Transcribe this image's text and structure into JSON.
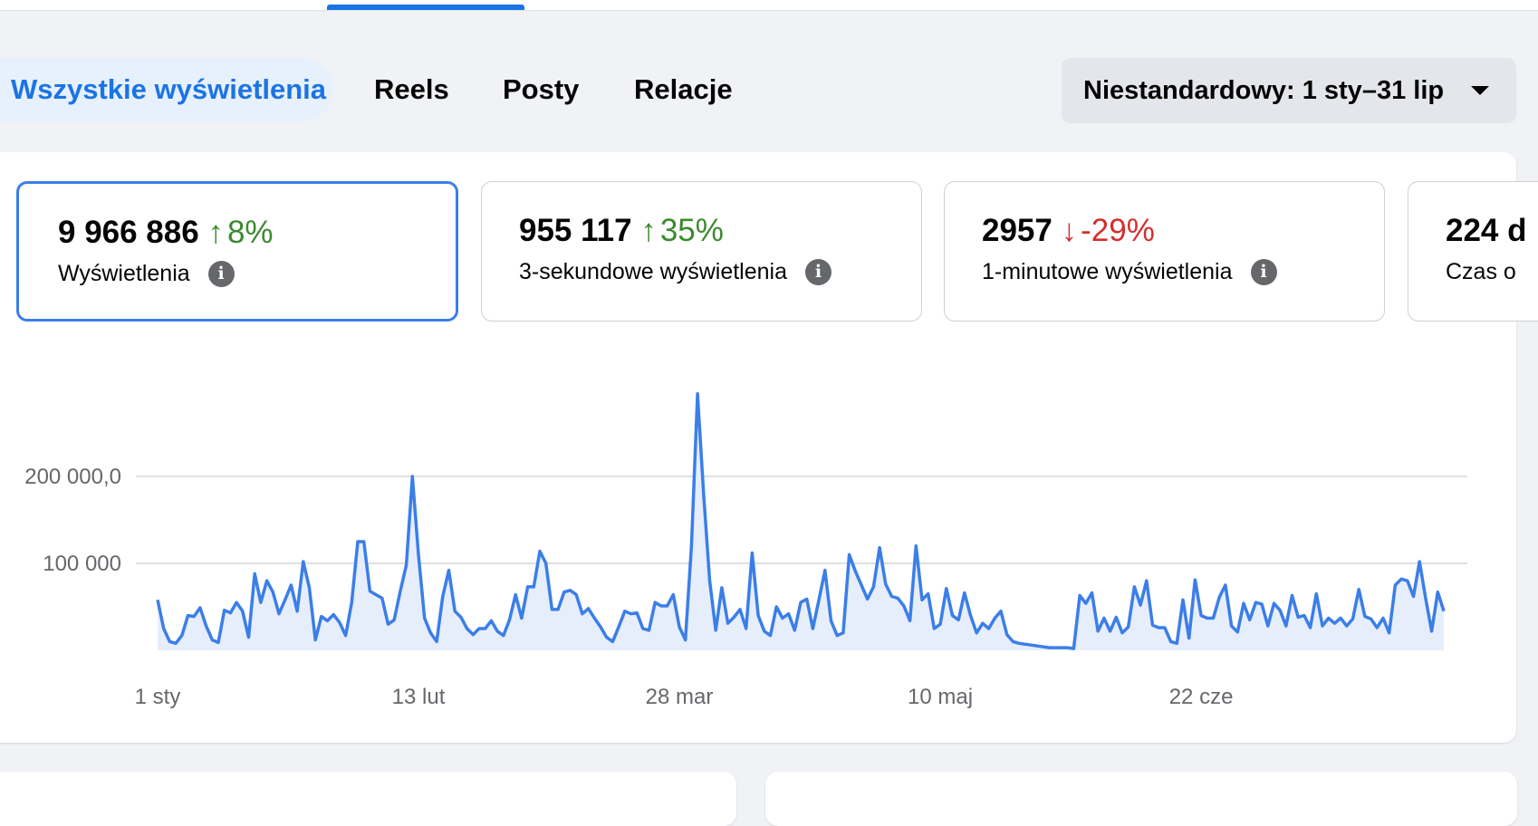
{
  "tabs": [
    {
      "label": "Wszystkie wyświetlenia",
      "active": true
    },
    {
      "label": "Reels",
      "active": false
    },
    {
      "label": "Posty",
      "active": false
    },
    {
      "label": "Relacje",
      "active": false
    }
  ],
  "date_filter": {
    "label": "Niestandardowy: 1 sty–31 lip",
    "icon": "caret-down-icon"
  },
  "metrics": [
    {
      "value": "9 966 886",
      "arrow": "↑",
      "change": "8%",
      "trend": "up",
      "label": "Wyświetlenia",
      "selected": true
    },
    {
      "value": "955 117",
      "arrow": "↑",
      "change": "35%",
      "trend": "up",
      "label": "3-sekundowe wyświetlenia",
      "selected": false
    },
    {
      "value": "2957",
      "arrow": "↓",
      "change": "-29%",
      "trend": "down",
      "label": "1-minutowe wyświetlenia",
      "selected": false
    },
    {
      "value": "224 d",
      "label": "Czas o"
    }
  ],
  "info_icon_glyph": "i",
  "colors": {
    "accent": "#1b74e4",
    "line": "#3b7ee8",
    "area": "#e6eefc",
    "up": "#3b8a2e",
    "down": "#d32f2f"
  },
  "chart_data": {
    "type": "area",
    "y_ticks": [
      {
        "value": 100000,
        "label": "100 000"
      },
      {
        "value": 200000,
        "label": "200 000,0"
      }
    ],
    "x_ticks": [
      {
        "day": 0,
        "label": "1 sty"
      },
      {
        "day": 43,
        "label": "13 lut"
      },
      {
        "day": 86,
        "label": "28 mar"
      },
      {
        "day": 129,
        "label": "10 maj"
      },
      {
        "day": 172,
        "label": "22 cze"
      }
    ],
    "ylim": [
      0,
      300000
    ],
    "grid": true,
    "x_start": "1 sty",
    "values": [
      58000,
      25000,
      10000,
      8000,
      17000,
      40000,
      39000,
      49000,
      28000,
      12000,
      9000,
      46000,
      43000,
      55000,
      45000,
      15000,
      88000,
      55000,
      80000,
      67000,
      42000,
      58000,
      75000,
      45000,
      102000,
      72000,
      12000,
      39000,
      34000,
      41000,
      32000,
      17000,
      55000,
      125000,
      125000,
      68000,
      64000,
      60000,
      30000,
      35000,
      68000,
      98000,
      200000,
      110000,
      37000,
      20000,
      10000,
      62000,
      92000,
      45000,
      38000,
      25000,
      18000,
      25000,
      25000,
      34000,
      22000,
      17000,
      35000,
      64000,
      37000,
      73000,
      73000,
      114000,
      100000,
      47000,
      47000,
      67000,
      69000,
      64000,
      42000,
      48000,
      37000,
      27000,
      15000,
      10000,
      27000,
      45000,
      42000,
      43000,
      25000,
      23000,
      55000,
      51000,
      51000,
      64000,
      27000,
      12000,
      120000,
      295000,
      180000,
      80000,
      23000,
      72000,
      31000,
      38000,
      47000,
      25000,
      112000,
      40000,
      22000,
      17000,
      50000,
      37000,
      42000,
      23000,
      55000,
      59000,
      25000,
      58000,
      92000,
      34000,
      17000,
      20000,
      110000,
      91000,
      75000,
      59000,
      73000,
      118000,
      76000,
      62000,
      60000,
      51000,
      34000,
      120000,
      58000,
      65000,
      25000,
      30000,
      71000,
      40000,
      35000,
      66000,
      40000,
      20000,
      31000,
      25000,
      37000,
      45000,
      18000,
      10000,
      8000,
      7000,
      6000,
      5000,
      4000,
      3000,
      3000,
      3000,
      3000,
      2000,
      63000,
      54000,
      66000,
      22000,
      37000,
      22000,
      38000,
      20000,
      27000,
      73000,
      52000,
      80000,
      29000,
      26000,
      26000,
      10000,
      8000,
      58000,
      14000,
      81000,
      40000,
      37000,
      37000,
      61000,
      75000,
      28000,
      21000,
      54000,
      35000,
      55000,
      53000,
      28000,
      54000,
      46000,
      28000,
      63000,
      38000,
      40000,
      26000,
      65000,
      28000,
      37000,
      31000,
      37000,
      28000,
      36000,
      70000,
      39000,
      36000,
      26000,
      37000,
      20000,
      75000,
      82000,
      80000,
      62000,
      102000,
      60000,
      22000,
      67000,
      45000
    ]
  }
}
